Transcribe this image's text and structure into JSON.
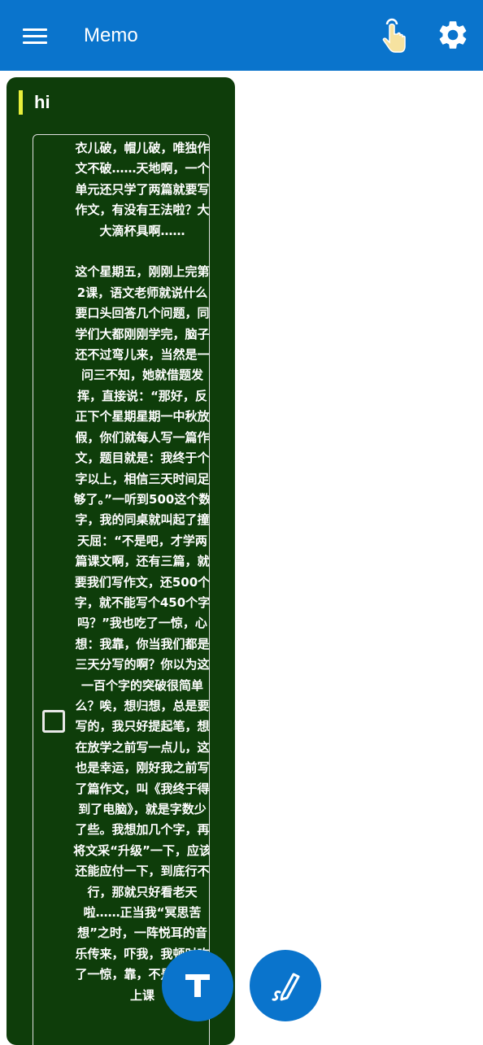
{
  "appbar": {
    "title": "Memo",
    "icons": [
      "menu-icon",
      "touch-hand-icon",
      "gear-icon"
    ]
  },
  "memo": {
    "title": "hi",
    "checked": false,
    "body": "衣儿破，帽儿破，唯独作文不破……天地啊，一个单元还只学了两篇就要写作文，有没有王法啦？大大滴杯具啊……\n\n这个星期五，刚刚上完第2课，语文老师就说什么要口头回答几个问题，同学们大都刚刚学完，脑子还不过弯儿来，当然是一问三不知，她就借题发挥，直接说：“那好，反正下个星期星期一中秋放假，你们就每人写一篇作文，题目就是：我终于个字以上，相信三天时间足够了。”一听到500这个数字，我的同桌就叫起了撞天屈：“不是吧，才学两篇课文啊，还有三篇，就要我们写作文，还500个字，就不能写个450个字吗？”我也吃了一惊，心想：我靠，你当我们都是三天分写的啊？你以为这一百个字的突破很简单么？唉，想归想，总是要写的，我只好提起笔，想在放学之前写一点儿，这也是幸运，刚好我之前写了篇作文，叫《我终于得到了电脑》，就是字数少了些。我想加几个字，再将文采“升级”一下，应该还能应付一下，到底行不行，那就只好看老天啦……正当我“冥思苦想”之时，一阵悦耳的音乐传来，吓我，我顿时吃了一惊，靠，不是那么快上课"
  },
  "fabs": {
    "text_icon": "text-format-icon",
    "pen_icon": "pen-icon"
  },
  "colors": {
    "appbar": "#0a74cc",
    "card": "#0e3d0a",
    "accent": "#e8ef3b",
    "fab": "#0a74cc"
  }
}
